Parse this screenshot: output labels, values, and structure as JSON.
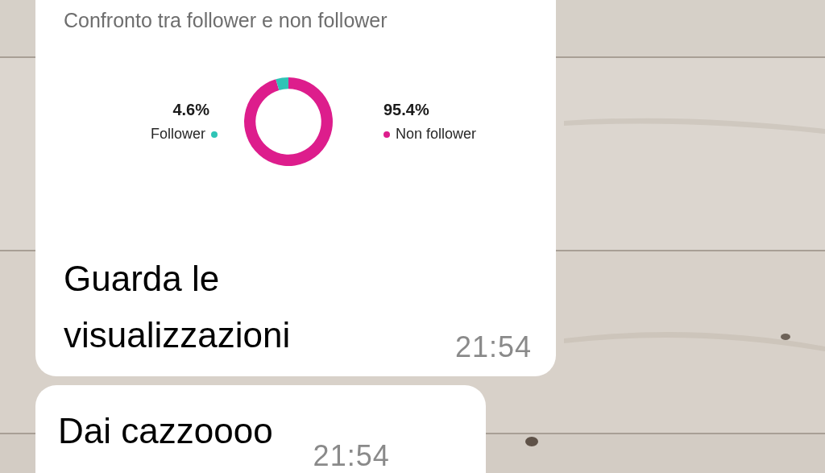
{
  "messages": [
    {
      "kind": "insight",
      "subtitle": "Confronto tra follower e non follower",
      "legend": [
        {
          "percent": "4.6%",
          "color": "#2ec4b6"
        },
        {
          "percent": "95.4%",
          "color": "#dd1d8c"
        }
      ],
      "chart_data": {
        "type": "donut",
        "categories": [
          "Follower",
          "Non follower"
        ],
        "values": [
          4.6,
          95.4
        ]
      },
      "text": "Guarda le visualizzazioni",
      "time": "21:54"
    },
    {
      "kind": "text",
      "text": "Dai cazzoooo",
      "time": "21:54"
    }
  ]
}
